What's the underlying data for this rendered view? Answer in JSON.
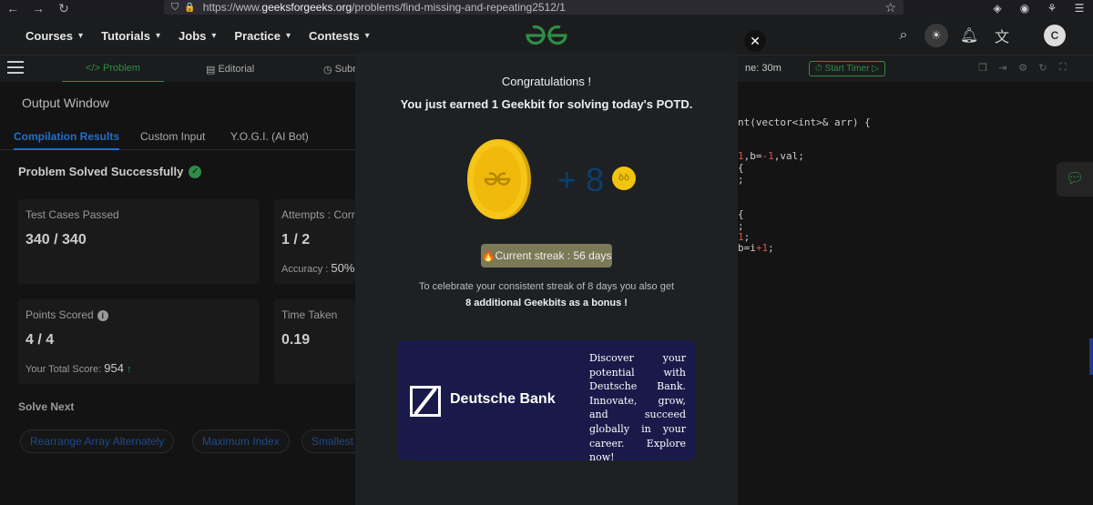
{
  "browser": {
    "url_prefix": "https://www.",
    "url_domain": "geeksforgeeks.org",
    "url_path": "/problems/find-missing-and-repeating2512/1"
  },
  "header": {
    "menu": [
      "Courses",
      "Tutorials",
      "Jobs",
      "Practice",
      "Contests"
    ],
    "avatar_letter": "C"
  },
  "problem_bar": {
    "tabs": [
      "Problem",
      "Editorial",
      "Subr"
    ],
    "timer_text": "ne: 30m",
    "start_timer": "Start Timer"
  },
  "output": {
    "title": "Output Window",
    "tabs": [
      "Compilation Results",
      "Custom Input",
      "Y.O.G.I. (AI Bot)"
    ],
    "status": "Problem Solved Successfully",
    "cards": {
      "test_cases_label": "Test Cases Passed",
      "test_cases_value": "340 / 340",
      "attempts_label": "Attempts : Corre",
      "attempts_value": "1 / 2",
      "accuracy_label": "Accuracy :",
      "accuracy_value": "50%",
      "points_label": "Points Scored",
      "points_value": "4 / 4",
      "total_score_label": "Your Total Score:",
      "total_score_value": "954",
      "time_label": "Time Taken",
      "time_value": "0.19"
    },
    "solve_next_title": "Solve Next",
    "solve_next": [
      "Rearrange Array Alternately",
      "Maximum Index",
      "Smallest"
    ]
  },
  "code": {
    "line1": "nt(vector<int>& arr) {",
    "line2a": "1",
    "line2b": ",b=",
    "line2c": "-1",
    "line2d": ",val;",
    "line3": " {",
    "line4": ";",
    "line5": "{",
    "line6": ";",
    "line7a": "1",
    "line7b": ";",
    "line8a": "b=i",
    "line8b": "+1",
    "line8c": ";"
  },
  "modal": {
    "title": "Congratulations !",
    "earned": "You just earned 1 Geekbit for solving today's POTD.",
    "plus": "+ 8",
    "streak": "🔥Current streak : 56 days",
    "bonus_line1": "To celebrate your consistent streak of 8 days you also get",
    "bonus_line2": "8 additional Geekbits as a bonus !",
    "ad": {
      "brand": "Deutsche Bank",
      "text": "Discover your potential with Deutsche Bank. Innovate, grow, and succeed globally in your career. Explore now!"
    }
  },
  "colors": {
    "accent_green": "#2f8d46",
    "accent_blue": "#1f6fd1",
    "coin_gold": "#f1c40f",
    "ad_bg": "#1a1a4a",
    "streak_bg": "#7c7957"
  }
}
